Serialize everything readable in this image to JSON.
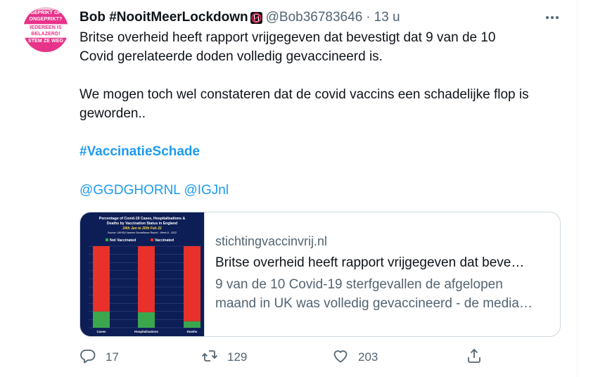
{
  "tweet": {
    "display_name": "Bob #NooitMeerLockdown",
    "handle": "@Bob36783646",
    "separator": "·",
    "time": "13 u",
    "avatar_lines": [
      "GEPRIKT OF ONGEPRIKT?",
      "IEDEREEN IS BELAZERD!",
      "STEM ZE WEG"
    ],
    "text_line1": "Britse overheid heeft rapport vrijgegeven dat bevestigt dat 9 van de 10",
    "text_line2": "Covid gerelateerde doden volledig gevaccineerd is.",
    "text_line3": "We mogen toch wel constateren dat de covid vaccins een schadelijke flop is",
    "text_line4": "geworden..",
    "hashtag": "#VaccinatieSchade",
    "mention1": "@GGDGHORNL",
    "mention2": "@IGJnl"
  },
  "card": {
    "domain": "stichtingvaccinvrij.nl",
    "title": "Britse overheid heeft rapport vrijgegeven dat beve…",
    "desc_line1": "9 van de 10 Covid-19 sterfgevallen de afgelopen",
    "desc_line2": "maand in UK was volledig gevaccineerd - de media…",
    "image": {
      "title1": "Percentage of Covid-19 Cases, Hospitalisations &",
      "title2": "Deaths by Vaccination Status in England",
      "date": "24th Jan to 20th Feb 22",
      "source": "Source: UKHSA Vaccine Surveillance Report - Week 8 - 2022",
      "legend_not_vaccinated": "Not Vaccinated",
      "legend_vaccinated": "Vaccinated"
    }
  },
  "chart_data": {
    "type": "bar",
    "categories": [
      "Cases",
      "Hospitalisations",
      "Deaths"
    ],
    "series": [
      {
        "name": "Not Vaccinated",
        "values": [
          20,
          19,
          8
        ]
      },
      {
        "name": "Vaccinated",
        "values": [
          80,
          81,
          92
        ]
      }
    ],
    "ylim": [
      0,
      100
    ]
  },
  "colors": {
    "link": "#1d9bf0",
    "chart_bg": "#0d1d55",
    "not_vaccinated": "#3aa74f",
    "vaccinated": "#e8312a"
  },
  "actions": {
    "reply_count": "17",
    "retweet_count": "129",
    "like_count": "203",
    "reply_icon": "reply-icon",
    "retweet_icon": "retweet-icon",
    "like_icon": "heart-icon",
    "share_icon": "share-icon"
  }
}
